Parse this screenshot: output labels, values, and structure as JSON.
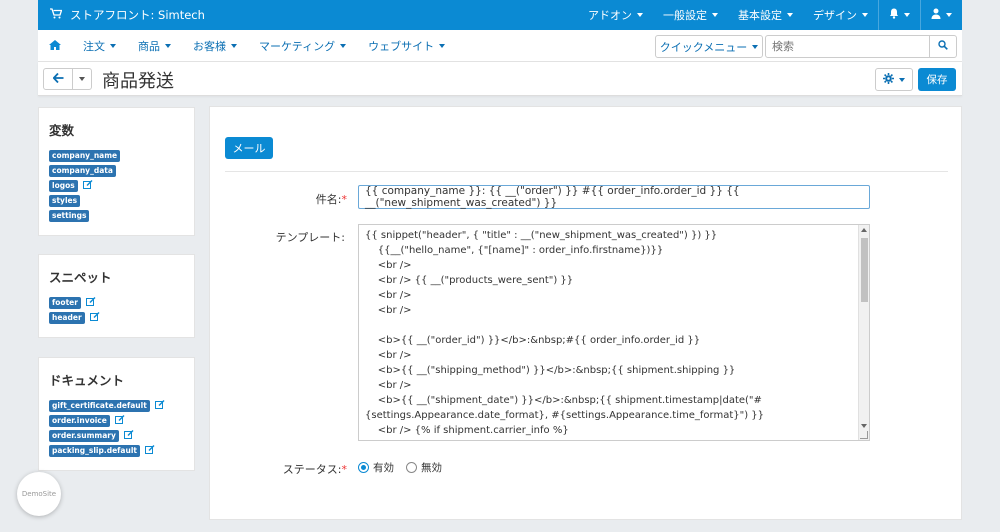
{
  "topbar": {
    "store_name": "ストアフロント: Simtech",
    "menus": [
      "アドオン",
      "一般設定",
      "基本設定",
      "デザイン"
    ],
    "colors": {
      "accent": "#0b8ad3"
    }
  },
  "nav": {
    "items": [
      "注文",
      "商品",
      "お客様",
      "マーケティング",
      "ウェブサイト"
    ],
    "quick_menu": "クイックメニュー",
    "search_placeholder": "検索"
  },
  "page": {
    "title": "商品発送",
    "save_label": "保存"
  },
  "sidebar": {
    "variables": {
      "title": "変数",
      "items": [
        "company_name",
        "company_data",
        "logos",
        "styles",
        "settings"
      ]
    },
    "snippets": {
      "title": "スニペット",
      "items": [
        "footer",
        "header"
      ]
    },
    "documents": {
      "title": "ドキュメント",
      "items": [
        "gift_certificate.default",
        "order.invoice",
        "order.summary",
        "packing_slip.default"
      ]
    }
  },
  "form": {
    "tab_label": "メール",
    "subject_label": "件名:",
    "subject_value": "{{ company_name }}: {{ __(\"order\") }} #{{ order_info.order_id }} {{ __(\"new_shipment_was_created\") }}",
    "template_label": "テンプレート:",
    "template_lines": [
      "{{ snippet(\"header\", { \"title\" : __(\"new_shipment_was_created\") }) }}",
      "    {{__(\"hello_name\", {\"[name]\" : order_info.firstname})}}",
      "    <br />",
      "    <br /> {{ __(\"products_were_sent\") }}",
      "    <br />",
      "    <br />",
      "",
      "    <b>{{ __(\"order_id\") }}</b>:&nbsp;#{{ order_info.order_id }}",
      "    <br />",
      "    <b>{{ __(\"shipping_method\") }}</b>:&nbsp;{{ shipment.shipping }}",
      "    <br />",
      "    <b>{{ __(\"shipment_date\") }}</b>:&nbsp;{{ shipment.timestamp|date(\"#{settings.Appearance.date_format}, #{settings.Appearance.time_format}\") }}",
      "    <br /> {% if shipment.carrier_info %}"
    ],
    "status_label": "ステータス:",
    "status_options": [
      "有効",
      "無効"
    ],
    "status_selected": "有効"
  },
  "demo_badge": "DemoSite"
}
